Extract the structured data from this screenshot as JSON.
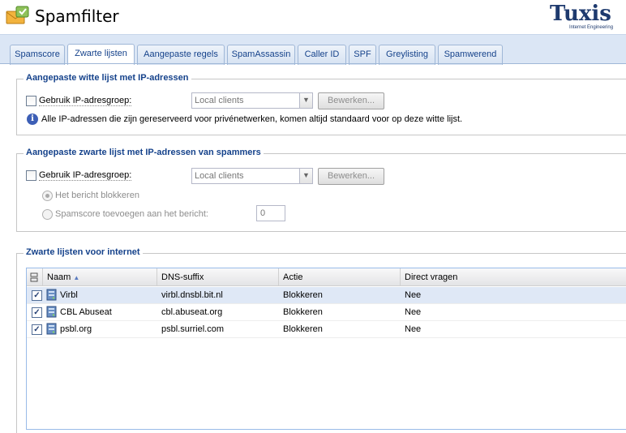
{
  "app": {
    "title": "Spamfilter",
    "logo_text": "Tuxis",
    "logo_subtitle": "Internet Engineering"
  },
  "tabs": [
    {
      "label": "Spamscore"
    },
    {
      "label": "Zwarte lijsten"
    },
    {
      "label": "Aangepaste regels"
    },
    {
      "label": "SpamAssassin"
    },
    {
      "label": "Caller ID"
    },
    {
      "label": "SPF"
    },
    {
      "label": "Greylisting"
    },
    {
      "label": "Spamwerend"
    }
  ],
  "active_tab": "Zwarte lijsten",
  "whitelist": {
    "legend": "Aangepaste witte lijst met IP-adressen",
    "use_group_label": "Gebruik IP-adresgroep:",
    "group_value": "Local clients",
    "edit_label": "Bewerken...",
    "info_text": "Alle IP-adressen die zijn gereserveerd voor privénetwerken, komen altijd standaard voor op deze witte lijst."
  },
  "blacklist": {
    "legend": "Aangepaste zwarte lijst met IP-adressen van spammers",
    "use_group_label": "Gebruik IP-adresgroep:",
    "group_value": "Local clients",
    "edit_label": "Bewerken...",
    "option_block": "Het bericht blokkeren",
    "option_score": "Spamscore toevoegen aan het bericht:",
    "score_value": "0"
  },
  "internet": {
    "legend": "Zwarte lijsten voor internet",
    "columns": [
      "Naam",
      "DNS-suffix",
      "Actie",
      "Direct vragen"
    ],
    "rows": [
      {
        "name": "Virbl",
        "dns": "virbl.dnsbl.bit.nl",
        "action": "Blokkeren",
        "direct": "Nee"
      },
      {
        "name": "CBL Abuseat",
        "dns": "cbl.abuseat.org",
        "action": "Blokkeren",
        "direct": "Nee"
      },
      {
        "name": "psbl.org",
        "dns": "psbl.surriel.com",
        "action": "Blokkeren",
        "direct": "Nee"
      }
    ]
  },
  "colors": {
    "accent": "#15428b",
    "tab_bg": "#dbe6f5",
    "selected_row": "#dfe8f6"
  }
}
